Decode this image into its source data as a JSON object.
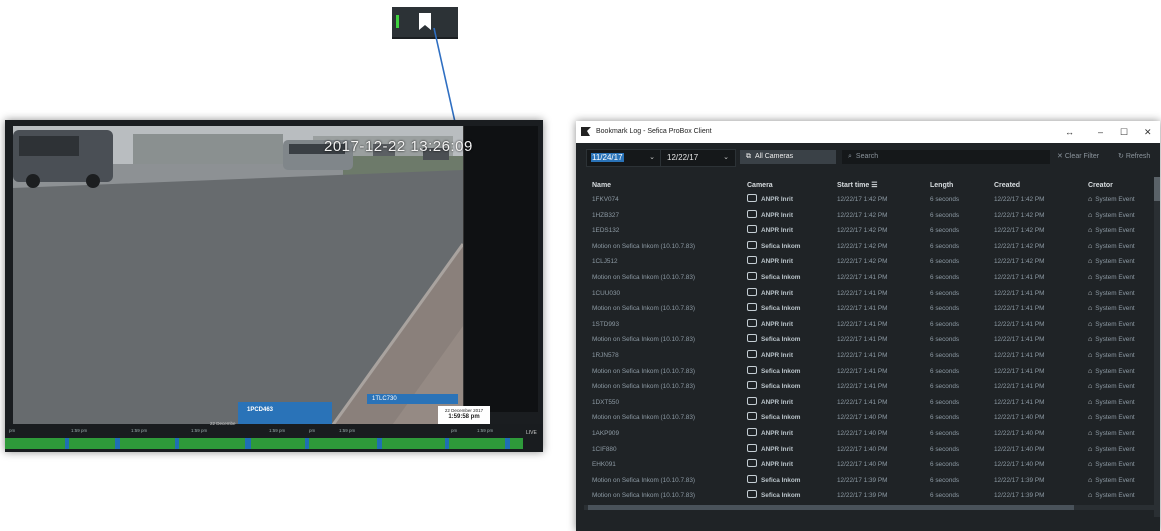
{
  "video_panel": {
    "timestamp": "2017-12-22 13:26:09",
    "bookmark_card": {
      "title": "1PCD463",
      "controls": "▶ ✎"
    },
    "plate_tag": "1TLC730",
    "date_tooltip": {
      "date": "22 December 2017",
      "time": "1:59:58 pm"
    },
    "timeline": {
      "mid_label": "22 Decembe",
      "live_label": "LIVE",
      "tick_labels": [
        "pm",
        "1:59 pm",
        "1:59 pm",
        "1:59 pm",
        "1:59 pm",
        "pm",
        "1:59 pm",
        "pm",
        "1:59 pm"
      ]
    }
  },
  "bookmark_log": {
    "window_title": "Bookmark Log - Sefica ProBox Client",
    "filters": {
      "start_date": "11/24/17",
      "end_date": "12/22/17",
      "camera": "All Cameras",
      "search_placeholder": "Search",
      "clear_filter": "Clear Filter",
      "refresh": "Refresh"
    },
    "columns": [
      "Name",
      "Camera",
      "Start time",
      "Length",
      "Created",
      "Creator"
    ],
    "rows": [
      {
        "name": "1FKV074",
        "camera": "ANPR Inrit",
        "start": "12/22/17 1:42 PM",
        "length": "6 seconds",
        "created": "12/22/17 1:42 PM",
        "creator": "System Event"
      },
      {
        "name": "1HZB327",
        "camera": "ANPR Inrit",
        "start": "12/22/17 1:42 PM",
        "length": "6 seconds",
        "created": "12/22/17 1:42 PM",
        "creator": "System Event"
      },
      {
        "name": "1EDS132",
        "camera": "ANPR Inrit",
        "start": "12/22/17 1:42 PM",
        "length": "6 seconds",
        "created": "12/22/17 1:42 PM",
        "creator": "System Event"
      },
      {
        "name": "Motion on Sefica Inkom (10.10.7.83)",
        "camera": "Sefica Inkom",
        "start": "12/22/17 1:42 PM",
        "length": "6 seconds",
        "created": "12/22/17 1:42 PM",
        "creator": "System Event"
      },
      {
        "name": "1CLJ512",
        "camera": "ANPR Inrit",
        "start": "12/22/17 1:42 PM",
        "length": "6 seconds",
        "created": "12/22/17 1:42 PM",
        "creator": "System Event"
      },
      {
        "name": "Motion on Sefica Inkom (10.10.7.83)",
        "camera": "Sefica Inkom",
        "start": "12/22/17 1:41 PM",
        "length": "6 seconds",
        "created": "12/22/17 1:41 PM",
        "creator": "System Event"
      },
      {
        "name": "1CUU030",
        "camera": "ANPR Inrit",
        "start": "12/22/17 1:41 PM",
        "length": "6 seconds",
        "created": "12/22/17 1:41 PM",
        "creator": "System Event"
      },
      {
        "name": "Motion on Sefica Inkom (10.10.7.83)",
        "camera": "Sefica Inkom",
        "start": "12/22/17 1:41 PM",
        "length": "6 seconds",
        "created": "12/22/17 1:41 PM",
        "creator": "System Event"
      },
      {
        "name": "1STD993",
        "camera": "ANPR Inrit",
        "start": "12/22/17 1:41 PM",
        "length": "6 seconds",
        "created": "12/22/17 1:41 PM",
        "creator": "System Event"
      },
      {
        "name": "Motion on Sefica Inkom (10.10.7.83)",
        "camera": "Sefica Inkom",
        "start": "12/22/17 1:41 PM",
        "length": "6 seconds",
        "created": "12/22/17 1:41 PM",
        "creator": "System Event"
      },
      {
        "name": "1RJN578",
        "camera": "ANPR Inrit",
        "start": "12/22/17 1:41 PM",
        "length": "6 seconds",
        "created": "12/22/17 1:41 PM",
        "creator": "System Event"
      },
      {
        "name": "Motion on Sefica Inkom (10.10.7.83)",
        "camera": "Sefica Inkom",
        "start": "12/22/17 1:41 PM",
        "length": "6 seconds",
        "created": "12/22/17 1:41 PM",
        "creator": "System Event"
      },
      {
        "name": "Motion on Sefica Inkom (10.10.7.83)",
        "camera": "Sefica Inkom",
        "start": "12/22/17 1:41 PM",
        "length": "6 seconds",
        "created": "12/22/17 1:41 PM",
        "creator": "System Event"
      },
      {
        "name": "1DXT550",
        "camera": "ANPR Inrit",
        "start": "12/22/17 1:41 PM",
        "length": "6 seconds",
        "created": "12/22/17 1:41 PM",
        "creator": "System Event"
      },
      {
        "name": "Motion on Sefica Inkom (10.10.7.83)",
        "camera": "Sefica Inkom",
        "start": "12/22/17 1:40 PM",
        "length": "6 seconds",
        "created": "12/22/17 1:40 PM",
        "creator": "System Event"
      },
      {
        "name": "1AKP909",
        "camera": "ANPR Inrit",
        "start": "12/22/17 1:40 PM",
        "length": "6 seconds",
        "created": "12/22/17 1:40 PM",
        "creator": "System Event"
      },
      {
        "name": "1CIF880",
        "camera": "ANPR Inrit",
        "start": "12/22/17 1:40 PM",
        "length": "6 seconds",
        "created": "12/22/17 1:40 PM",
        "creator": "System Event"
      },
      {
        "name": "EHK091",
        "camera": "ANPR Inrit",
        "start": "12/22/17 1:40 PM",
        "length": "6 seconds",
        "created": "12/22/17 1:40 PM",
        "creator": "System Event"
      },
      {
        "name": "Motion on Sefica Inkom (10.10.7.83)",
        "camera": "Sefica Inkom",
        "start": "12/22/17 1:39 PM",
        "length": "6 seconds",
        "created": "12/22/17 1:39 PM",
        "creator": "System Event"
      },
      {
        "name": "Motion on Sefica Inkom (10.10.7.83)",
        "camera": "Sefica Inkom",
        "start": "12/22/17 1:39 PM",
        "length": "6 seconds",
        "created": "12/22/17 1:39 PM",
        "creator": "System Event"
      }
    ]
  },
  "colors": {
    "window_bg": "#1f2326",
    "accent_blue": "#2a73b8",
    "timeline_green": "#2e9a3a",
    "indicator_green": "#3fd13f"
  }
}
